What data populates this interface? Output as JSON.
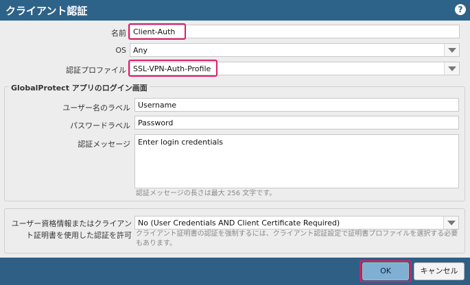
{
  "dialog": {
    "title": "クライアント認証",
    "help_icon": "?"
  },
  "form": {
    "name_label": "名前",
    "name_value": "Client-Auth",
    "os_label": "OS",
    "os_value": "Any",
    "auth_profile_label": "認証プロファイル",
    "auth_profile_value": "SSL-VPN-Auth-Profile"
  },
  "login_section": {
    "legend": "GlobalProtect アプリのログイン画面",
    "username_label_label": "ユーザー名のラベル",
    "username_label_value": "Username",
    "password_label_label": "パスワードラベル",
    "password_label_value": "Password",
    "auth_message_label": "認証メッセージ",
    "auth_message_value": "Enter login credentials",
    "auth_message_hint": "認証メッセージの長さは最大 256 文字です。"
  },
  "credentials_section": {
    "label_line1": "ユーザー資格情報またはクライアン",
    "label_line2": "ト証明書を使用した認証を許可",
    "select_value": "No (User Credentials AND Client Certificate Required)",
    "hint_line1": "クライアント証明書の認証を強制するには、クライアント認証設定で証明書プロファイルを選択する必要",
    "hint_line2": "もあります。"
  },
  "footer": {
    "ok_label": "OK",
    "cancel_label": "キャンセル"
  },
  "colors": {
    "titlebar": "#2e6389",
    "highlight": "#e01b6a",
    "ok_button": "#7fb0d3"
  }
}
